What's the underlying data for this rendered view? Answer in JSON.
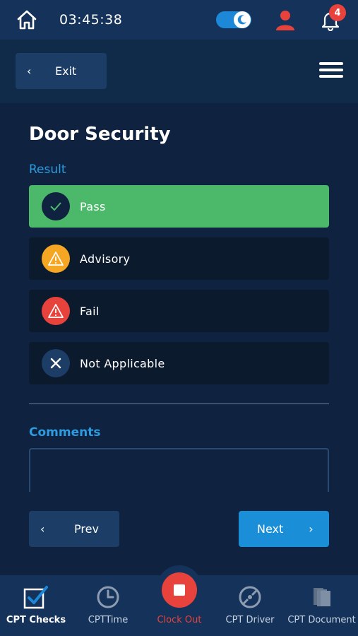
{
  "status_bar": {
    "time": "03:45:38",
    "notification_count": "4"
  },
  "header": {
    "exit_label": "Exit"
  },
  "page": {
    "title": "Door Security",
    "result_label": "Result",
    "comments_label": "Comments",
    "comments_value": ""
  },
  "options": [
    {
      "label": "Pass",
      "icon": "check-icon",
      "selected": true
    },
    {
      "label": "Advisory",
      "icon": "warning-icon",
      "selected": false
    },
    {
      "label": "Fail",
      "icon": "warning-icon",
      "selected": false
    },
    {
      "label": "Not Applicable",
      "icon": "close-icon",
      "selected": false
    }
  ],
  "nav_buttons": {
    "prev_label": "Prev",
    "next_label": "Next"
  },
  "bottom_nav": [
    {
      "label": "CPT Checks",
      "icon": "checkbox-icon",
      "active": true
    },
    {
      "label": "CPTTime",
      "icon": "clock-icon",
      "active": false
    },
    {
      "label": "Clock Out",
      "icon": "stop-icon",
      "active": false
    },
    {
      "label": "CPT Driver",
      "icon": "steering-wheel-icon",
      "active": false
    },
    {
      "label": "CPT Document",
      "icon": "document-icon",
      "active": false
    }
  ],
  "colors": {
    "background": "#0f2340",
    "accent": "#1a8fd8",
    "pass": "#4cb96a",
    "advisory": "#f5a623",
    "fail": "#e8423c"
  }
}
